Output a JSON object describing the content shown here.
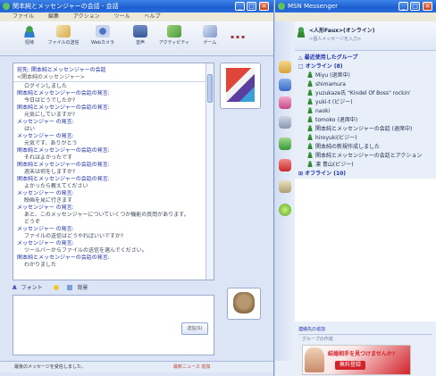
{
  "chat_window": {
    "title": "関本純とメッセンジャーの会話 - 会話",
    "menu": [
      "ファイル",
      "編集",
      "アクション",
      "ツール",
      "ヘルプ"
    ],
    "toolbar": [
      {
        "label": "招待",
        "icon": "invite-icon"
      },
      {
        "label": "ファイルの送信",
        "icon": "send-file-icon"
      },
      {
        "label": "Webカメラ",
        "icon": "webcam-icon"
      },
      {
        "label": "音声",
        "icon": "voice-icon"
      },
      {
        "label": "アクティビティ",
        "icon": "activity-icon"
      },
      {
        "label": "ゲーム",
        "icon": "game-icon"
      }
    ],
    "header": {
      "to_line": "宛先: 関本純とメッセンジャーの会話",
      "sub_line": "<関本純のメッセンジャー>"
    },
    "messages": [
      {
        "kind": "m",
        "text": "ログインしました"
      },
      {
        "kind": "h",
        "text": "関本純とメッセンジャーの会話の発言:"
      },
      {
        "kind": "m",
        "text": "今日はどうでしたか?"
      },
      {
        "kind": "h",
        "text": "関本純とメッセンジャーの会話の発言:"
      },
      {
        "kind": "m",
        "text": "元気にしていますか?"
      },
      {
        "kind": "h",
        "text": "メッセンジャー の発言:"
      },
      {
        "kind": "m",
        "text": "はい"
      },
      {
        "kind": "h",
        "text": "メッセンジャー の発言:"
      },
      {
        "kind": "m",
        "text": "元気です、ありがとう"
      },
      {
        "kind": "h",
        "text": "関本純とメッセンジャーの会話の発言:"
      },
      {
        "kind": "m",
        "text": "それはよかったです"
      },
      {
        "kind": "h",
        "text": "関本純とメッセンジャーの会話の発言:"
      },
      {
        "kind": "m",
        "text": "週末は何をしますか?"
      },
      {
        "kind": "h",
        "text": "関本純とメッセンジャーの会話の発言:"
      },
      {
        "kind": "m",
        "text": "よかったら教えてください"
      },
      {
        "kind": "h",
        "text": "メッセンジャー の発言:"
      },
      {
        "kind": "m",
        "text": "映画を見に行きます"
      },
      {
        "kind": "h",
        "text": "メッセンジャー の発言:"
      },
      {
        "kind": "m",
        "text": "あと、このメッセンジャーについていくつか機能の質問があります。"
      },
      {
        "kind": "m",
        "text": "どうぞ"
      },
      {
        "kind": "h",
        "text": "メッセンジャー の発言:"
      },
      {
        "kind": "m",
        "text": "ファイルの送信はどうやればいいですか?"
      },
      {
        "kind": "h",
        "text": "メッセンジャー の発言:"
      },
      {
        "kind": "m",
        "text": "ツールバーからファイルの送信を選んでください。"
      },
      {
        "kind": "h",
        "text": "関本純とメッセンジャーの会話の発言:"
      },
      {
        "kind": "m",
        "text": "わかりました"
      }
    ],
    "format_bar": {
      "font_label": "フォント",
      "emoticon_label": "",
      "bg_label": "背景"
    },
    "send_button": "送信(S)",
    "status_bar": "最後のメッセージを受信しました。",
    "status_bar_right": "最新ニュース 追加"
  },
  "messenger_window": {
    "title": "MSN Messenger",
    "user_line": "<人形Faux>(オンライン)",
    "sub_line": "<個人メッセージを入力>",
    "groups": [
      {
        "type": "group",
        "label": "△ 最近使用したグループ"
      },
      {
        "type": "group",
        "label": "□ オンライン (8)"
      },
      {
        "type": "contact",
        "label": "Miyu (退席中)"
      },
      {
        "type": "contact",
        "label": "shimamura"
      },
      {
        "type": "contact",
        "label": "yuzukaze氏 \"Kindel Of Boss\" rockin'"
      },
      {
        "type": "contact",
        "label": "yuki-t (ビジー)"
      },
      {
        "type": "contact",
        "label": "naoki"
      },
      {
        "type": "contact",
        "label": "tomoko (退席中)"
      },
      {
        "type": "contact",
        "label": "関本純とメッセンジャーの会話 (退席中)"
      },
      {
        "type": "contact",
        "label": "hiroyuki(ビジー)"
      },
      {
        "type": "contact",
        "label": "関本純の新規作成しました"
      },
      {
        "type": "contact",
        "label": "関本純とメッセンジャーの会話とアクション"
      },
      {
        "type": "contact",
        "label": "凛 青山(ビジー)"
      },
      {
        "type": "group",
        "label": "⊞ オフライン (10)"
      }
    ],
    "bottom_link": "連絡先の追加",
    "bottom_sub": "グループの作成",
    "ad_line1": "結婚相手を見つけませんか?",
    "ad_line2": "無料登録"
  },
  "colors": {
    "title_blue": "#1e5fd0",
    "panel_bg": "#dbe5f6",
    "link_blue": "#1c2fa8",
    "ad_red": "#d2232a"
  }
}
